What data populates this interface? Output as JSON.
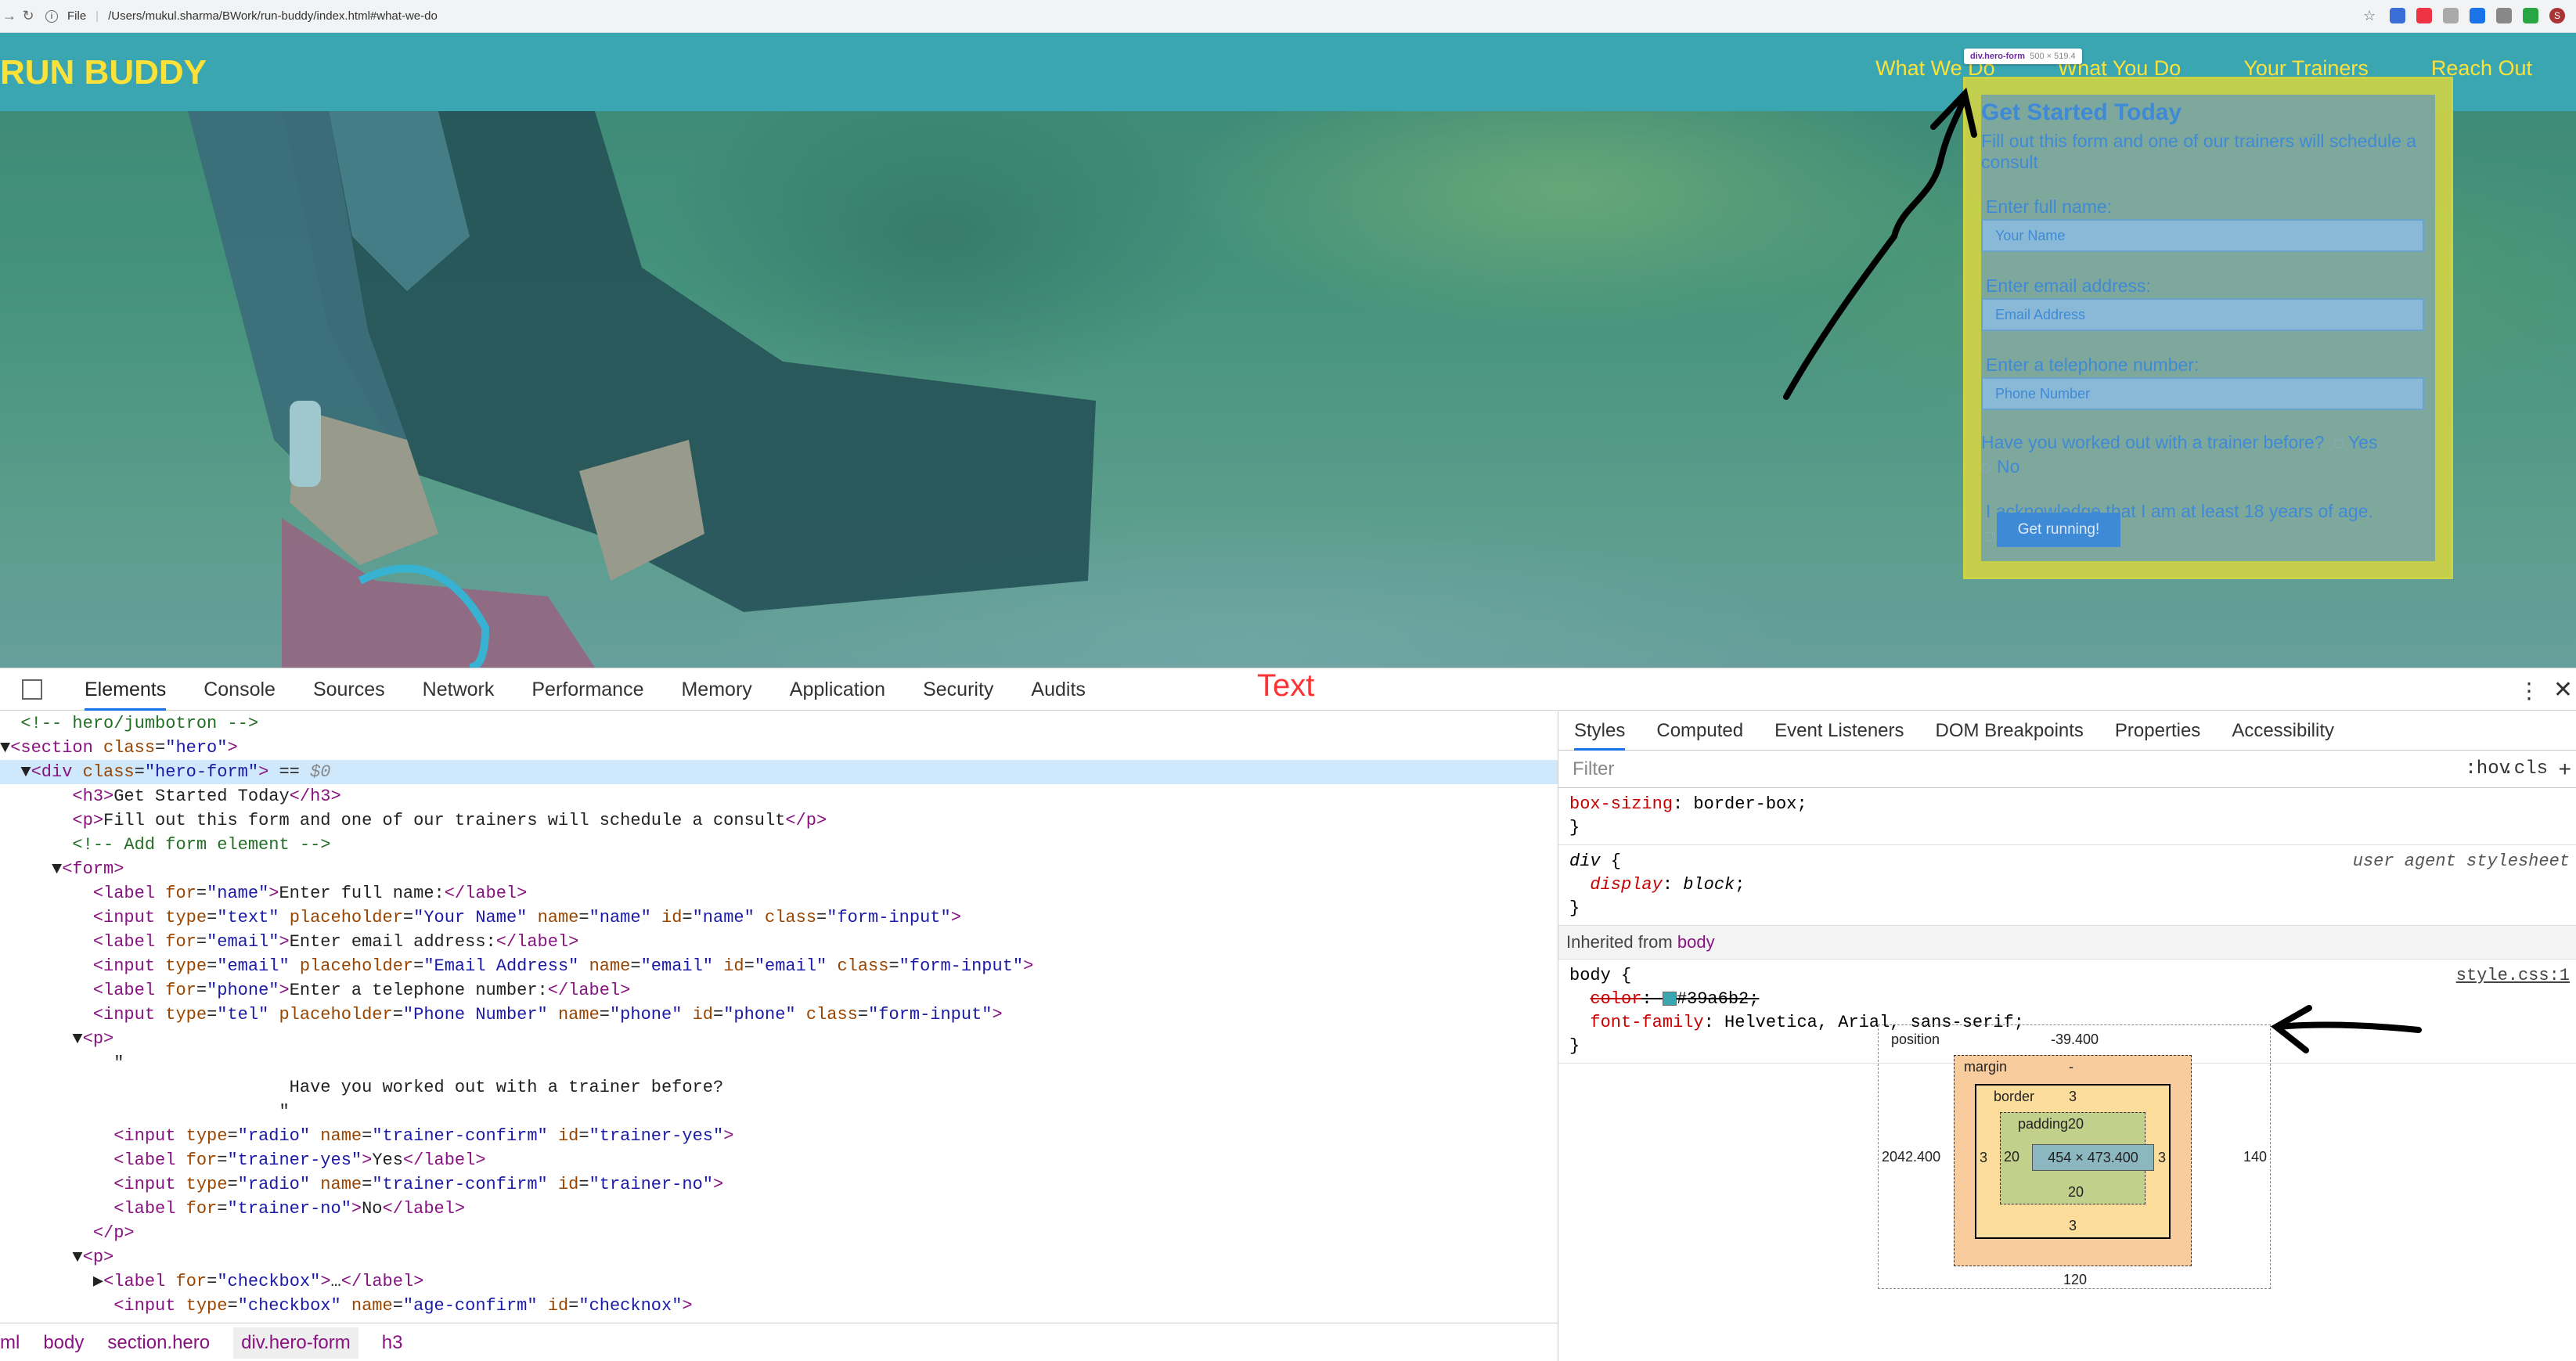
{
  "browser": {
    "file_label": "File",
    "url": "/Users/mukul.sharma/BWork/run-buddy/index.html#what-we-do",
    "profile": "S"
  },
  "site": {
    "logo": "RUN BUDDY",
    "menu": [
      "What We Do",
      "What You Do",
      "Your Trainers",
      "Reach Out"
    ]
  },
  "tooltip": {
    "selector": "div.hero-form",
    "size": "500 × 519.4"
  },
  "form": {
    "title": "Get Started Today",
    "subtitle": "Fill out this form and one of our trainers will schedule a consult",
    "name_label": "Enter full name:",
    "name_ph": "Your Name",
    "email_label": "Enter email address:",
    "email_ph": "Email Address",
    "phone_label": "Enter a telephone number:",
    "phone_ph": "Phone Number",
    "trainer_q": "Have you worked out with a trainer before?",
    "yes": "Yes",
    "no": "No",
    "age": "I acknowledge that I am at least 18 years of age.",
    "submit": "Get running!"
  },
  "devtools": {
    "tabs": [
      "Elements",
      "Console",
      "Sources",
      "Network",
      "Performance",
      "Memory",
      "Application",
      "Security",
      "Audits"
    ],
    "annotation": "Text",
    "side_tabs": [
      "Styles",
      "Computed",
      "Event Listeners",
      "DOM Breakpoints",
      "Properties",
      "Accessibility"
    ],
    "filter": "Filter",
    "hov": ":hov",
    ".cls": ".cls",
    "breadcrumbs": [
      "ml",
      "body",
      "section.hero",
      "div.hero-form",
      "h3"
    ],
    "inherited": "Inherited from",
    "inherited_from": "body",
    "ua": "user agent stylesheet",
    "source": "style.css:1",
    "box_model": {
      "position": "position",
      "pos_top": "-39.400",
      "pos_left": "2042.400",
      "pos_right": "140",
      "pos_bottom": "120",
      "margin": "margin",
      "margin_val": "-",
      "border": "border",
      "border_val": "3",
      "padding": "padding",
      "padding_val": "20",
      "content": "454 × 473.400"
    }
  }
}
